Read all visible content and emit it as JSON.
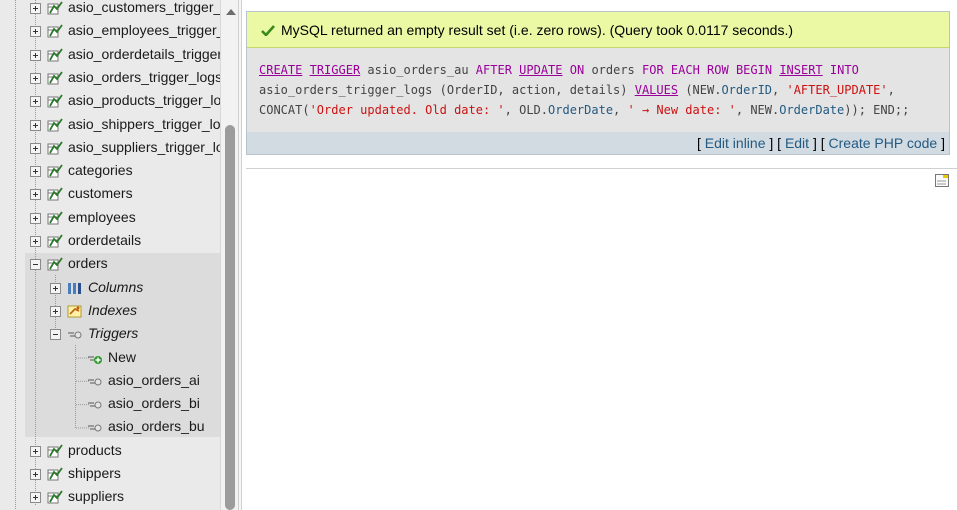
{
  "nav": {
    "items": [
      {
        "label": "asio_customers_trigger_lo",
        "type": "table"
      },
      {
        "label": "asio_employees_trigger_lo",
        "type": "table"
      },
      {
        "label": "asio_orderdetails_trigger_",
        "type": "table"
      },
      {
        "label": "asio_orders_trigger_logs",
        "type": "table"
      },
      {
        "label": "asio_products_trigger_logs",
        "type": "table"
      },
      {
        "label": "asio_shippers_trigger_logs",
        "type": "table"
      },
      {
        "label": "asio_suppliers_trigger_log",
        "type": "table"
      },
      {
        "label": "categories",
        "type": "table"
      },
      {
        "label": "customers",
        "type": "table"
      },
      {
        "label": "employees",
        "type": "table"
      },
      {
        "label": "orderdetails",
        "type": "table"
      },
      {
        "label": "orders",
        "type": "table",
        "expanded": true
      },
      {
        "label": "Columns",
        "type": "columns"
      },
      {
        "label": "Indexes",
        "type": "indexes"
      },
      {
        "label": "Triggers",
        "type": "triggers",
        "expanded": true
      },
      {
        "label": "New",
        "type": "new"
      },
      {
        "label": "asio_orders_ai",
        "type": "trigger"
      },
      {
        "label": "asio_orders_bi",
        "type": "trigger"
      },
      {
        "label": "asio_orders_bu",
        "type": "trigger"
      },
      {
        "label": "products",
        "type": "table"
      },
      {
        "label": "shippers",
        "type": "table"
      },
      {
        "label": "suppliers",
        "type": "table"
      }
    ]
  },
  "result": {
    "message": "MySQL returned an empty result set (i.e. zero rows). (Query took 0.0117 seconds.)",
    "sql": {
      "create": "CREATE",
      "trigger": "TRIGGER",
      "name": "asio_orders_au",
      "after": "AFTER",
      "update": "UPDATE",
      "on": "ON",
      "table": "orders",
      "for_each_row_begin": "FOR EACH ROW BEGIN",
      "insert": "INSERT",
      "into": "INTO",
      "target": "asio_orders_trigger_logs",
      "cols_open": "(OrderID,",
      "col_action": "action,",
      "col_details": "details)",
      "values": "VALUES",
      "new_prefix": "(NEW.",
      "new_orderid": "OrderID",
      "str_after_update": "'AFTER_UPDATE'",
      "concat": "CONCAT(",
      "str_old": "'Order updated. Old date: '",
      "old_prefix": "OLD.",
      "order_date": "OrderDate",
      "str_new": "' → New date: '",
      "new2_prefix": "NEW.",
      "order_date2": "OrderDate",
      "close": ")); END;;"
    },
    "actions": {
      "edit_inline": "Edit inline",
      "edit": "Edit",
      "create_php": "Create PHP code"
    }
  },
  "colors": {
    "success_bg": "#ebf8a4",
    "keyword": "#990099",
    "string": "#cc1111",
    "link": "#235a81"
  }
}
